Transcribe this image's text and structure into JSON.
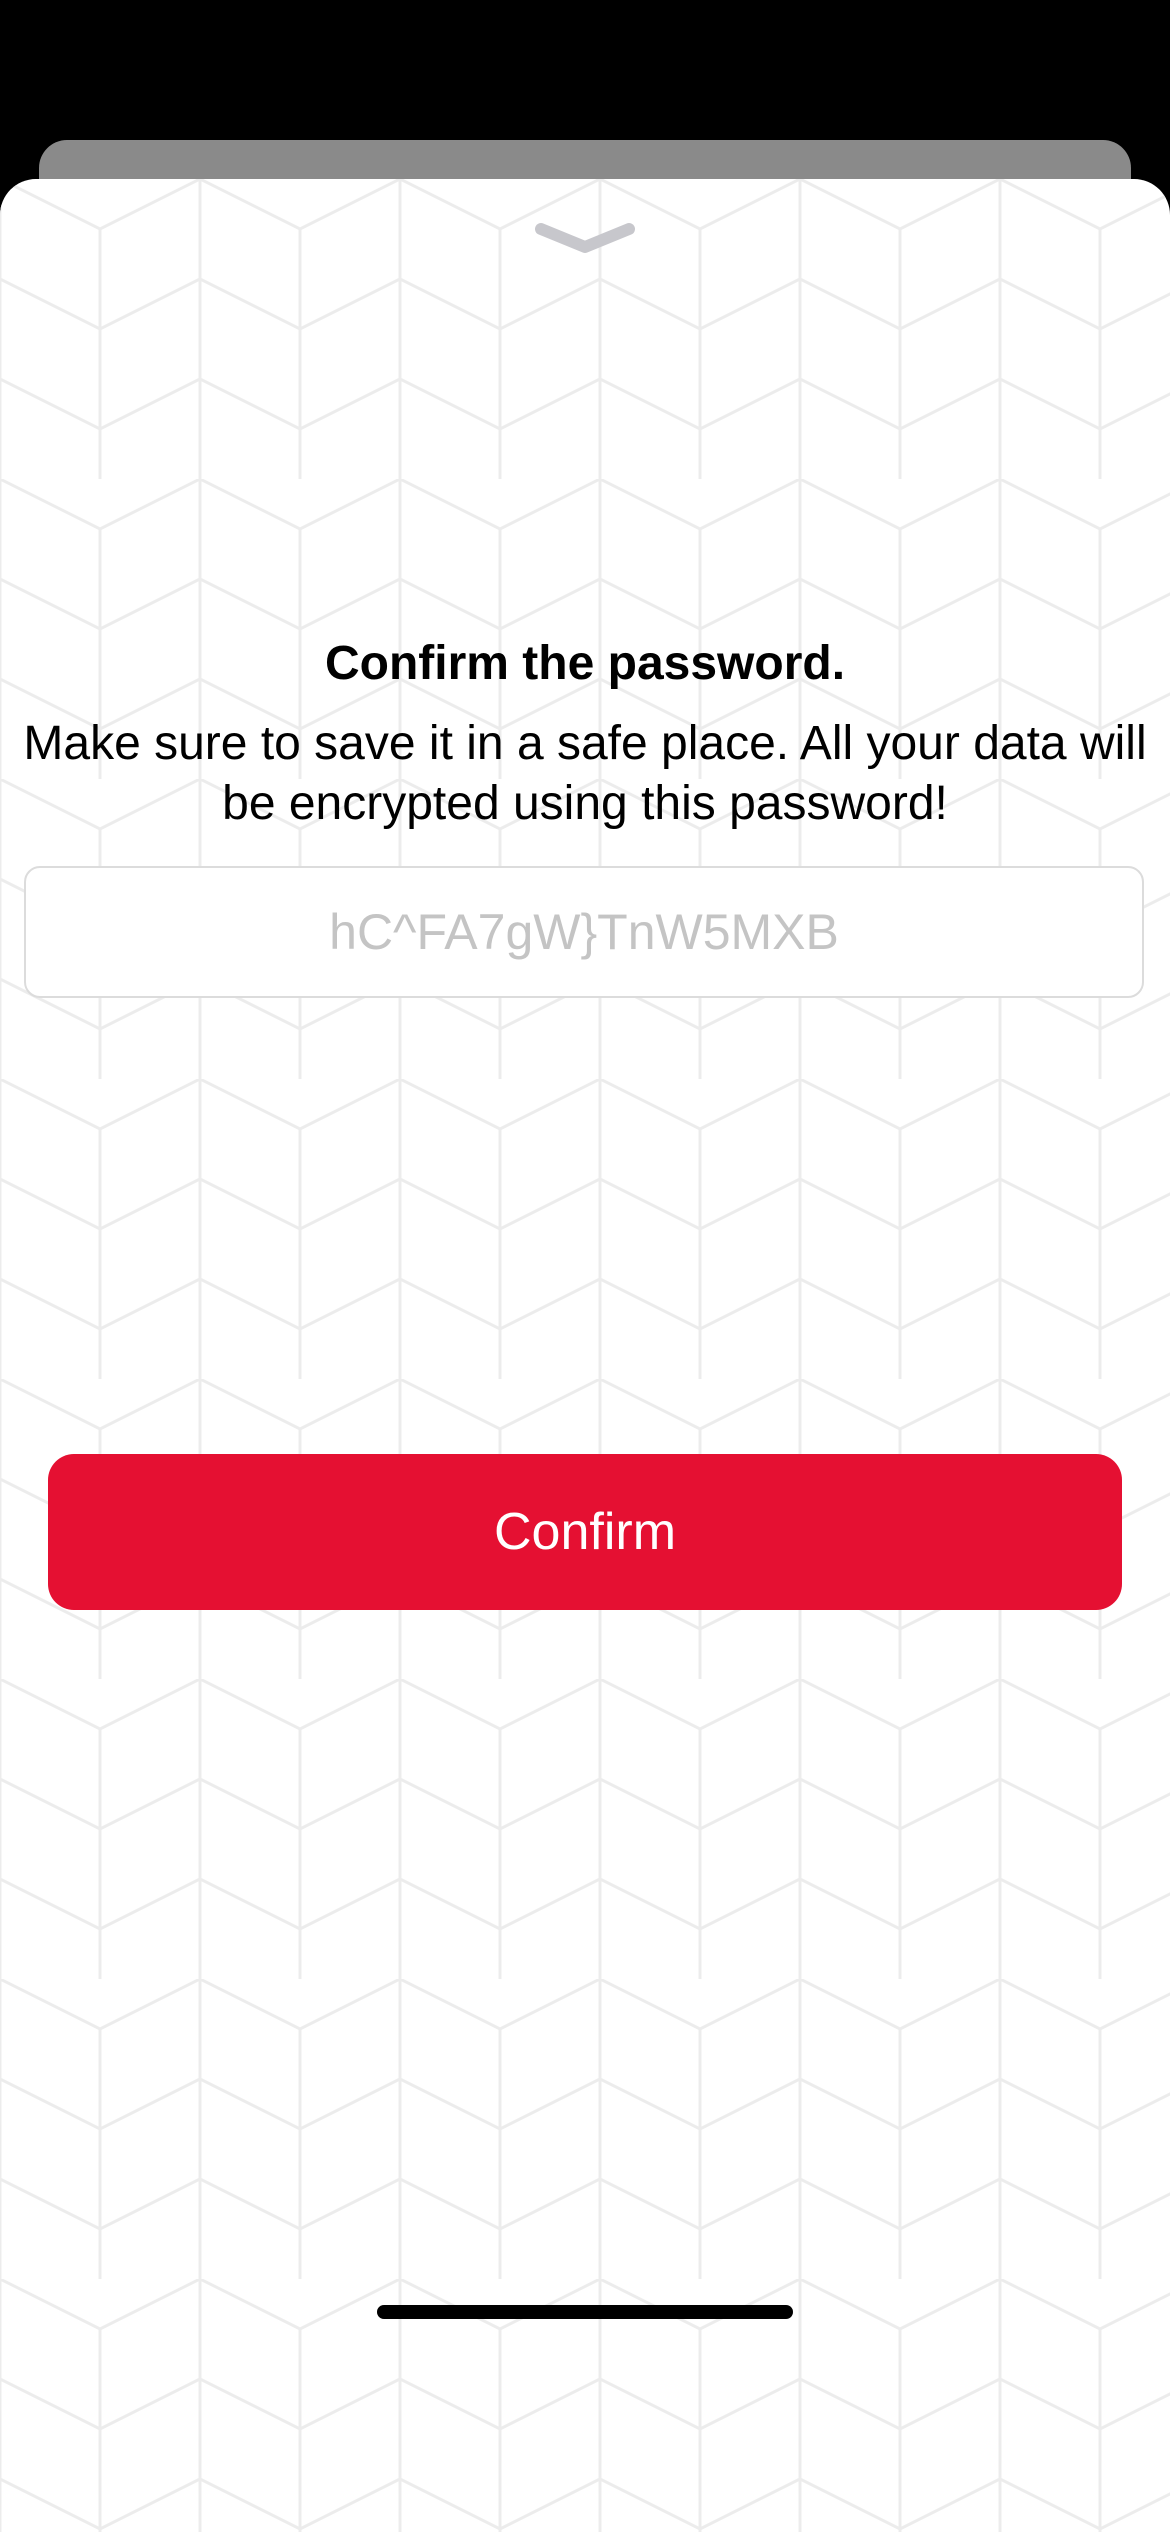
{
  "dialog": {
    "title": "Confirm the password.",
    "message": "Make sure to save it in a safe place. All your data will be encrypted using this password!",
    "password_field": {
      "value": "",
      "placeholder": "hC^FA7gW}TnW5MXB"
    },
    "confirm_label": "Confirm"
  },
  "icons": {
    "grabber": "chevron-down-icon"
  },
  "colors": {
    "accent": "#e51032",
    "background": "#ffffff",
    "placeholder": "#c4c4c4",
    "field_border": "#dcdcdc"
  }
}
